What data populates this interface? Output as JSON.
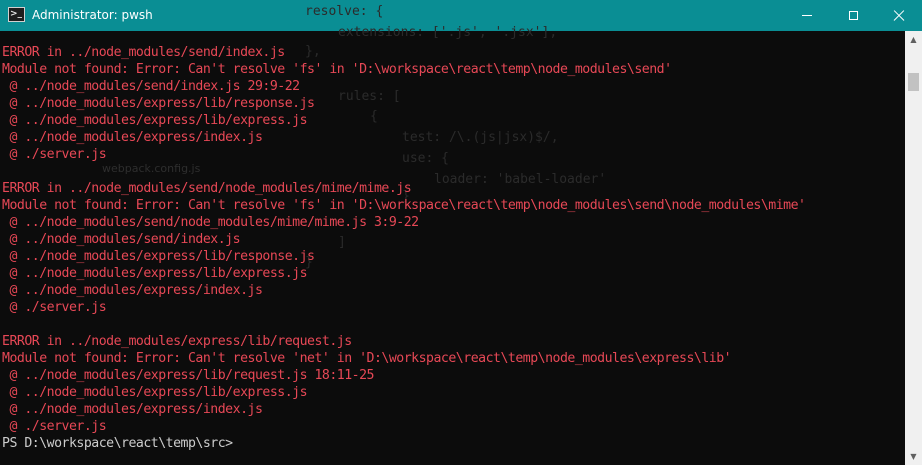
{
  "window": {
    "title": "Administrator: pwsh",
    "icon_glyph": ">_"
  },
  "ghost_text": [
    "resolve: {",
    "extensions: ['.js', '.jsx'],",
    "},",
    "rules: [",
    "{",
    "test: /\\.(js|jsx)$/,",
    "use: {",
    "loader: 'babel-loader'",
    "}",
    "]",
    "}",
    "webpack.config.js"
  ],
  "terminal": {
    "lines": [
      {
        "type": "err",
        "text": "ERROR in ../node_modules/send/index.js"
      },
      {
        "type": "err",
        "text": "Module not found: Error: Can't resolve 'fs' in 'D:\\workspace\\react\\temp\\node_modules\\send'"
      },
      {
        "type": "err",
        "text": " @ ../node_modules/send/index.js 29:9-22"
      },
      {
        "type": "err",
        "text": " @ ../node_modules/express/lib/response.js"
      },
      {
        "type": "err",
        "text": " @ ../node_modules/express/lib/express.js"
      },
      {
        "type": "err",
        "text": " @ ../node_modules/express/index.js"
      },
      {
        "type": "err",
        "text": " @ ./server.js"
      },
      {
        "type": "blank",
        "text": ""
      },
      {
        "type": "err",
        "text": "ERROR in ../node_modules/send/node_modules/mime/mime.js"
      },
      {
        "type": "err",
        "text": "Module not found: Error: Can't resolve 'fs' in 'D:\\workspace\\react\\temp\\node_modules\\send\\node_modules\\mime'"
      },
      {
        "type": "err",
        "text": " @ ../node_modules/send/node_modules/mime/mime.js 3:9-22"
      },
      {
        "type": "err",
        "text": " @ ../node_modules/send/index.js"
      },
      {
        "type": "err",
        "text": " @ ../node_modules/express/lib/response.js"
      },
      {
        "type": "err",
        "text": " @ ../node_modules/express/lib/express.js"
      },
      {
        "type": "err",
        "text": " @ ../node_modules/express/index.js"
      },
      {
        "type": "err",
        "text": " @ ./server.js"
      },
      {
        "type": "blank",
        "text": ""
      },
      {
        "type": "err",
        "text": "ERROR in ../node_modules/express/lib/request.js"
      },
      {
        "type": "err",
        "text": "Module not found: Error: Can't resolve 'net' in 'D:\\workspace\\react\\temp\\node_modules\\express\\lib'"
      },
      {
        "type": "err",
        "text": " @ ../node_modules/express/lib/request.js 18:11-25"
      },
      {
        "type": "err",
        "text": " @ ../node_modules/express/lib/express.js"
      },
      {
        "type": "err",
        "text": " @ ../node_modules/express/index.js"
      },
      {
        "type": "err",
        "text": " @ ./server.js"
      },
      {
        "type": "prompt",
        "text": "PS D:\\workspace\\react\\temp\\src>"
      }
    ]
  },
  "scrollbar": {
    "up_glyph": "▲",
    "down_glyph": "▼"
  },
  "colors": {
    "titlebar": "#0a8e94",
    "error_text": "#e74856",
    "prompt_text": "#cccccc",
    "background": "#0c0c0c"
  }
}
